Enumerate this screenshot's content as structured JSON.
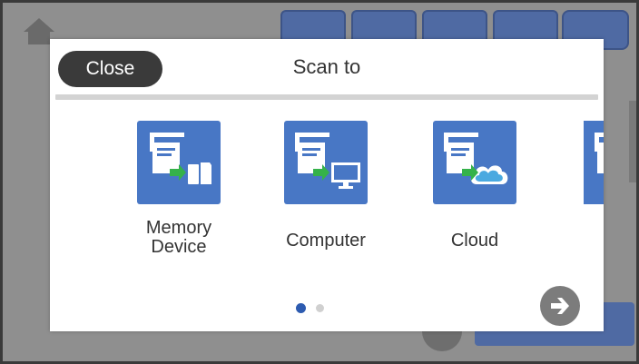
{
  "dialog": {
    "title": "Scan to",
    "close_label": "Close"
  },
  "destinations": [
    {
      "label_line1": "Memory",
      "label_line2": "Device",
      "icon": "memory-device-icon"
    },
    {
      "label": "Computer",
      "icon": "computer-icon"
    },
    {
      "label": "Cloud",
      "icon": "cloud-icon"
    }
  ],
  "pagination": {
    "current_page": 1,
    "page_count": 2
  },
  "colors": {
    "tile": "#4877c5",
    "close_button": "#3a3a3a",
    "active_dot": "#2d5bb0",
    "inactive_dot": "#d0d0d0",
    "next_button": "#7c7c7c"
  }
}
